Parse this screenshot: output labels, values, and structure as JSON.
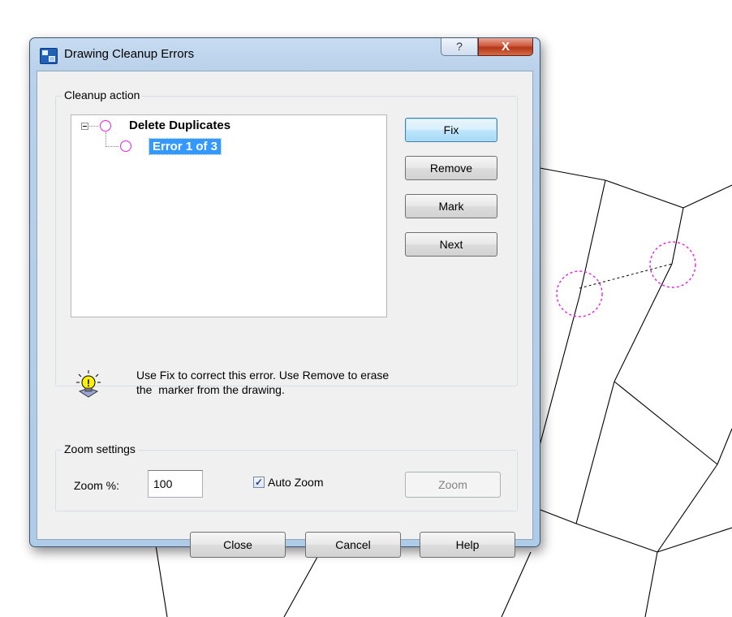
{
  "dialog": {
    "title": "Drawing Cleanup Errors",
    "help_glyph": "?",
    "close_glyph": "X"
  },
  "cleanup": {
    "group_label": "Cleanup action",
    "tree": {
      "root_label": "Delete Duplicates",
      "child_label": "Error 1 of 3"
    },
    "buttons": {
      "fix": "Fix",
      "remove": "Remove",
      "mark": "Mark",
      "next": "Next"
    },
    "hint_line1": "Use Fix to correct this error. Use Remove to erase",
    "hint_line2": "the  marker from the drawing."
  },
  "zoom": {
    "group_label": "Zoom settings",
    "zoom_label": "Zoom %:",
    "zoom_value": "100",
    "auto_zoom_label": "Auto Zoom",
    "auto_zoom_checked": true,
    "check_glyph": "✓",
    "zoom_button": "Zoom"
  },
  "footer": {
    "close": "Close",
    "cancel": "Cancel",
    "help": "Help"
  },
  "colors": {
    "marker": "#e520e5",
    "selection": "#3399ff"
  }
}
